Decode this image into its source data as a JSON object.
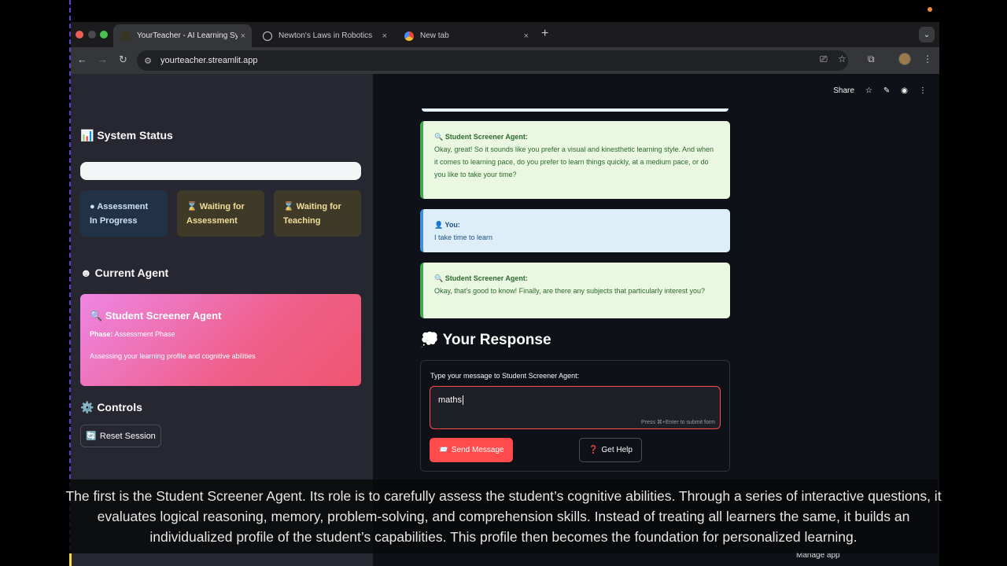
{
  "browser": {
    "tabs": [
      {
        "label": "YourTeacher - AI Learning Sy",
        "close": "×",
        "active": true
      },
      {
        "label": "Newton's Laws in Robotics",
        "close": "×",
        "active": false
      },
      {
        "label": "New tab",
        "close": "×",
        "active": false
      }
    ],
    "new_tab": "+",
    "tab_menu": "⌄",
    "url": "yourteacher.streamlit.app"
  },
  "sidebar": {
    "system_status_title": "📊 System Status",
    "progress": 1.0,
    "status_cards": [
      {
        "icon": "●",
        "line1": "Assessment",
        "line2": "In Progress"
      },
      {
        "icon": "⌛",
        "line1": "Waiting for",
        "line2": "Assessment"
      },
      {
        "icon": "⌛",
        "line1": "Waiting for",
        "line2": "Teaching"
      }
    ],
    "current_agent_title": "☻ Current Agent",
    "agent": {
      "name": "🔍 Student Screener Agent",
      "phase_label": "Phase:",
      "phase_value": "Assessment Phase",
      "description": "Assessing your learning profile and cognitive abilities"
    },
    "controls_title": "⚙️ Controls",
    "reset_button": "Reset Session",
    "reset_icon": "🔄"
  },
  "header_actions": {
    "share": "Share"
  },
  "chat": {
    "messages": [
      {
        "who": "🔍 Student Screener Agent:",
        "role": "agent",
        "text": "Okay, great! So it sounds like you prefer a visual and kinesthetic learning style. And when it comes to learning pace, do you prefer to learn things quickly, at a medium pace, or do you like to take your time?"
      },
      {
        "who": "👤 You:",
        "role": "user",
        "text": "I take time to learn"
      },
      {
        "who": "🔍 Student Screener Agent:",
        "role": "agent",
        "text": "Okay, that's good to know! Finally, are there any subjects that particularly interest you?"
      }
    ]
  },
  "response": {
    "title": "💭 Your Response",
    "label": "Type your message to Student Screener Agent:",
    "value": "maths",
    "hint": "Press ⌘+Enter to submit form",
    "send_button": "Send Message",
    "send_icon": "📨",
    "help_button": "Get Help",
    "help_icon": "❓"
  },
  "manage_app": "Manage app",
  "caption": "The first is the Student Screener Agent. Its role is to carefully assess the student’s cognitive abilities. Through a series of interactive questions, it evaluates logical reasoning, memory, problem-solving, and comprehension skills. Instead of treating all learners the same, it builds an individualized profile of the student’s capabilities. This profile then becomes the foundation for personalized learning.",
  "colors": {
    "accent": "#ff4b4b",
    "agent_gradient_start": "#ee86e4",
    "agent_gradient_end": "#f0556f",
    "agent_msg_bg": "#eaf7e1",
    "user_msg_bg": "#deeef9"
  }
}
